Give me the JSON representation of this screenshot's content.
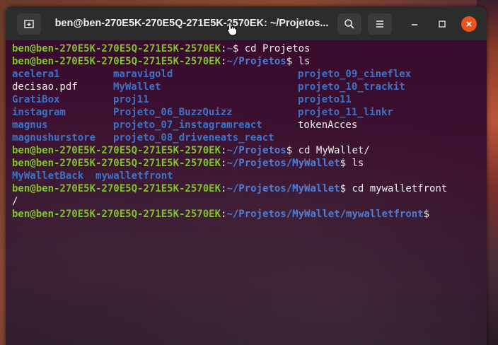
{
  "window": {
    "title": "ben@ben-270E5K-270E5Q-271E5K-2570EK: ~/Projetos..."
  },
  "colors": {
    "user_host": "#7ec42a",
    "path": "#4d7ed8",
    "directory": "#3b74c9",
    "close_button": "#e95420"
  },
  "terminal": {
    "user_host": "ben@ben-270E5K-270E5Q-271E5K-2570EK",
    "lines": [
      {
        "path": "~",
        "command": "cd Projetos"
      },
      {
        "path": "~/Projetos",
        "command": "ls"
      }
    ],
    "ls_projetos": [
      [
        {
          "name": "acelera1",
          "type": "dir"
        },
        {
          "name": "maravigold",
          "type": "dir"
        },
        {
          "name": "projeto_09_cineflex",
          "type": "dir"
        }
      ],
      [
        {
          "name": "decisao.pdf",
          "type": "file"
        },
        {
          "name": "MyWallet",
          "type": "dir"
        },
        {
          "name": "projeto_10_trackit",
          "type": "dir"
        }
      ],
      [
        {
          "name": "GratiBox",
          "type": "dir"
        },
        {
          "name": "proj11",
          "type": "dir"
        },
        {
          "name": "projeto11",
          "type": "dir"
        }
      ],
      [
        {
          "name": "instagram",
          "type": "dir"
        },
        {
          "name": "Projeto_06_BuzzQuizz",
          "type": "dir"
        },
        {
          "name": "projeto_11_linkr",
          "type": "dir"
        }
      ],
      [
        {
          "name": "magnus",
          "type": "dir"
        },
        {
          "name": "projeto_07_instagramreact",
          "type": "dir"
        },
        {
          "name": "tokenAcces",
          "type": "file"
        }
      ],
      [
        {
          "name": "magnushurstore",
          "type": "dir"
        },
        {
          "name": "projeto_08_driveneats_react",
          "type": "dir"
        },
        {
          "name": "",
          "type": "file"
        }
      ]
    ],
    "cmd3": {
      "path": "~/Projetos",
      "command": "cd MyWallet/"
    },
    "cmd4": {
      "path": "~/Projetos/MyWallet",
      "command": "ls"
    },
    "ls_mywallet": {
      "a": "MyWalletBack",
      "b": "mywalletfront"
    },
    "cmd5": {
      "path": "~/Projetos/MyWallet",
      "command": "cd mywalletfront",
      "wrap": "/"
    },
    "cmd6": {
      "path": "~/Projetos/MyWallet/mywalletfront",
      "command": ""
    }
  }
}
